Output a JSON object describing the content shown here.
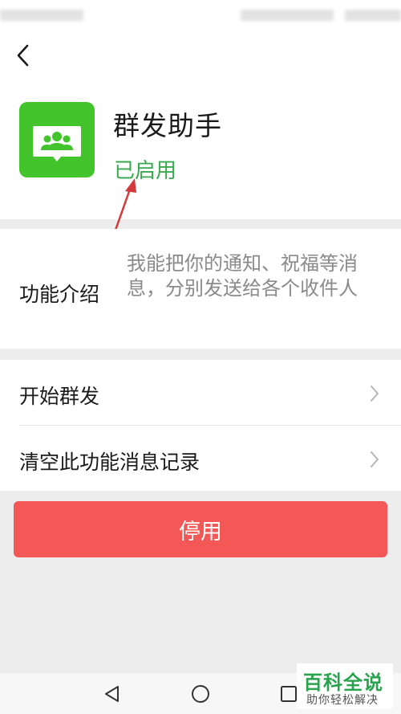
{
  "header": {
    "back_icon": "chevron-left-icon"
  },
  "app": {
    "icon": "group-broadcast-icon",
    "icon_color": "#43c42c",
    "title": "群发助手",
    "status": "已启用",
    "status_color": "#3aa84e"
  },
  "intro": {
    "label": "功能介绍",
    "text": "我能把你的通知、祝福等消息，分别发送给各个收件人"
  },
  "menu": {
    "items": [
      {
        "label": "开始群发",
        "icon": "chevron-right-icon"
      },
      {
        "label": "清空此功能消息记录",
        "icon": "chevron-right-icon"
      }
    ]
  },
  "actions": {
    "disable_label": "停用",
    "disable_color": "#f35756"
  },
  "nav": {
    "back_icon": "triangle-back-icon",
    "home_icon": "circle-home-icon",
    "recent_icon": "square-recent-icon"
  },
  "watermark": {
    "title": "百科全说",
    "subtitle": "助你轻松解决"
  },
  "annotation": {
    "color": "#d23a3a",
    "type": "red-arrow"
  }
}
